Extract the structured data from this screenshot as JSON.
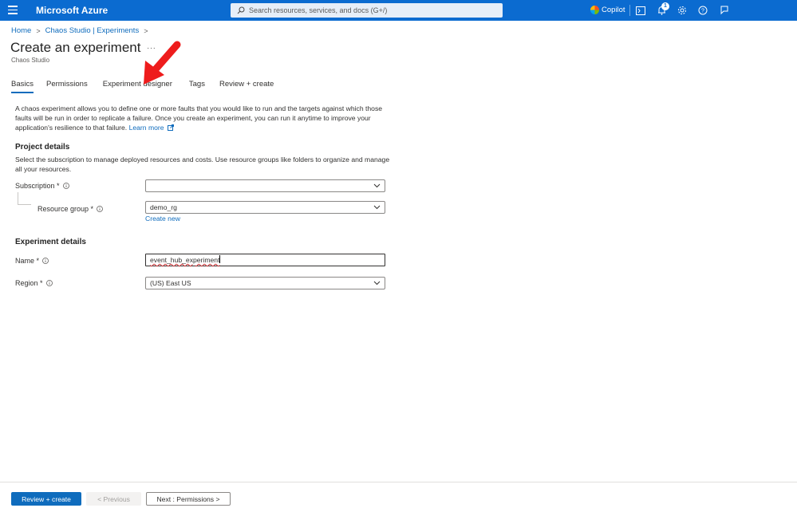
{
  "topbar": {
    "brand": "Microsoft Azure",
    "search_placeholder": "Search resources, services, and docs (G+/)",
    "copilot_label": "Copilot",
    "notification_count": "1",
    "color": "#0b6bd0",
    "icons": [
      "menu-icon",
      "search-icon",
      "copilot-icon",
      "cloud-shell-icon",
      "bell-icon",
      "gear-icon",
      "help-icon",
      "feedback-icon"
    ]
  },
  "breadcrumb": {
    "home": "Home",
    "experiments": "Chaos Studio | Experiments"
  },
  "page": {
    "title": "Create an experiment",
    "more": "···",
    "subtitle": "Chaos Studio"
  },
  "tabs": [
    {
      "label": "Basics",
      "active": true
    },
    {
      "label": "Permissions"
    },
    {
      "label": "Experiment designer"
    },
    {
      "label": "Tags"
    },
    {
      "label": "Review + create"
    }
  ],
  "intro": {
    "text": "A chaos experiment allows you to define one or more faults that you would like to run and the targets against which those faults will be run in order to replicate a failure. Once you create an experiment, you can run it anytime to improve your application's resilience to that failure.",
    "learn_more": "Learn more"
  },
  "project_details": {
    "heading": "Project details",
    "description": "Select the subscription to manage deployed resources and costs. Use resource groups like folders to organize and manage all your resources.",
    "subscription_label": "Subscription *",
    "subscription_value": "",
    "resource_group_label": "Resource group *",
    "resource_group_value": "demo_rg",
    "create_new": "Create new"
  },
  "experiment_details": {
    "heading": "Experiment details",
    "name_label": "Name *",
    "name_value": "event_hub_experiment",
    "region_label": "Region *",
    "region_value": "(US) East US"
  },
  "footer": {
    "review_create": "Review + create",
    "previous": "< Previous",
    "next": "Next : Permissions >"
  }
}
